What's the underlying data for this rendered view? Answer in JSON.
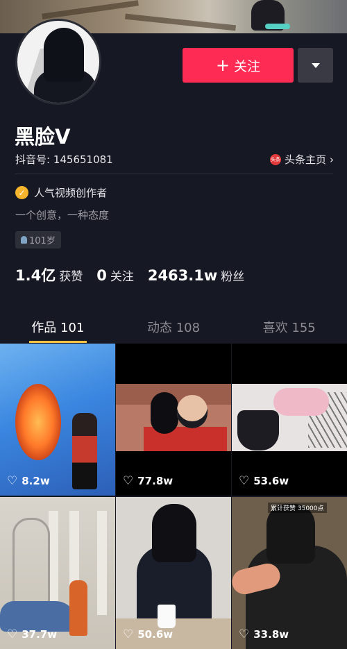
{
  "profile": {
    "nickname": "黑脸V",
    "uid_label": "抖音号: 145651081",
    "toutiao_link": "头条主页",
    "toutiao_logo_text": "头条",
    "verified_label": "人气视频创作者",
    "bio": "一个创意，一种态度",
    "age_tag": "101岁"
  },
  "actions": {
    "follow_label": "关注",
    "follow_icon": "+",
    "follow_color": "#fe2c55"
  },
  "stats": [
    {
      "value": "1.4亿",
      "label": "获赞"
    },
    {
      "value": "0",
      "label": "关注"
    },
    {
      "value": "2463.1w",
      "label": "粉丝"
    }
  ],
  "tabs": [
    {
      "label": "作品 101",
      "active": true
    },
    {
      "label": "动态 108",
      "active": false
    },
    {
      "label": "喜欢 155",
      "active": false
    }
  ],
  "videos": [
    {
      "likes": "8.2w"
    },
    {
      "likes": "77.8w"
    },
    {
      "likes": "53.6w"
    },
    {
      "likes": "37.7w"
    },
    {
      "likes": "50.6w"
    },
    {
      "likes": "33.8w"
    }
  ],
  "video6_caption": "累计获赞 35000点",
  "colors": {
    "background": "#161823",
    "accent": "#fe2c55",
    "tab_indicator": "#f6c242",
    "verified_badge": "#f6b52c"
  }
}
